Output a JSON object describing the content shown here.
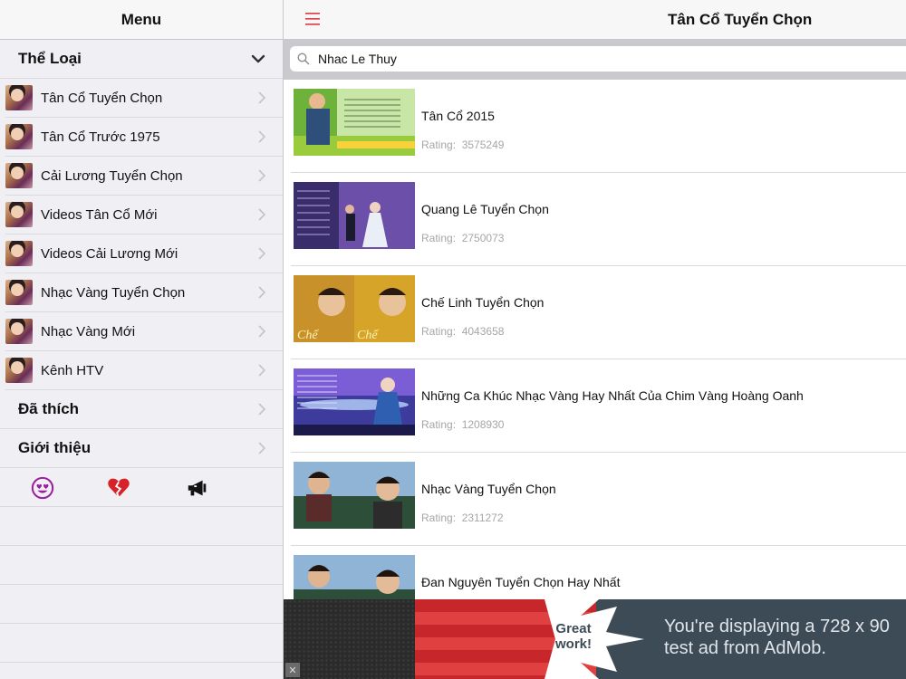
{
  "menu": {
    "title": "Menu",
    "section_genres": "Thể Loại",
    "categories": [
      {
        "label": "Tân Cổ Tuyển Chọn"
      },
      {
        "label": "Tân Cổ Trước 1975"
      },
      {
        "label": "Cải Lương Tuyển Chọn"
      },
      {
        "label": "Videos Tân Cổ Mới"
      },
      {
        "label": "Videos Cải Lương Mới"
      },
      {
        "label": "Nhạc Vàng Tuyển Chọn"
      },
      {
        "label": "Nhạc Vàng Mới"
      },
      {
        "label": "Kênh HTV"
      }
    ],
    "favorites": "Đã thích",
    "about": "Giới thiệu",
    "icons": [
      "heart-eyes-emoji-icon",
      "broken-heart-icon",
      "megaphone-icon"
    ]
  },
  "main": {
    "title": "Tân Cổ Tuyển Chọn",
    "search": {
      "value": "Nhac Le Thuy",
      "placeholder": ""
    },
    "rating_label": "Rating:",
    "items": [
      {
        "title": "Tân Cổ 2015",
        "rating": "3575249"
      },
      {
        "title": "Quang Lê Tuyển Chọn",
        "rating": "2750073"
      },
      {
        "title": "Chế Linh Tuyển Chọn",
        "rating": "4043658"
      },
      {
        "title": "Những Ca Khúc Nhạc Vàng Hay Nhất Của Chim Vàng Hoàng Oanh",
        "rating": "1208930"
      },
      {
        "title": "Nhạc Vàng Tuyển Chọn",
        "rating": "2311272"
      },
      {
        "title": "Đan Nguyên Tuyển Chọn Hay Nhất",
        "rating": ""
      }
    ]
  },
  "ad": {
    "close": "✕",
    "badge_line1": "Great",
    "badge_line2": "work!",
    "text": "You're displaying a 728 x 90 test ad from AdMob."
  },
  "colors": {
    "accent": "#e0383e",
    "rating": "#a6a6a6",
    "emoji_purple": "#9b1fa0",
    "heart_red": "#d8222a"
  }
}
